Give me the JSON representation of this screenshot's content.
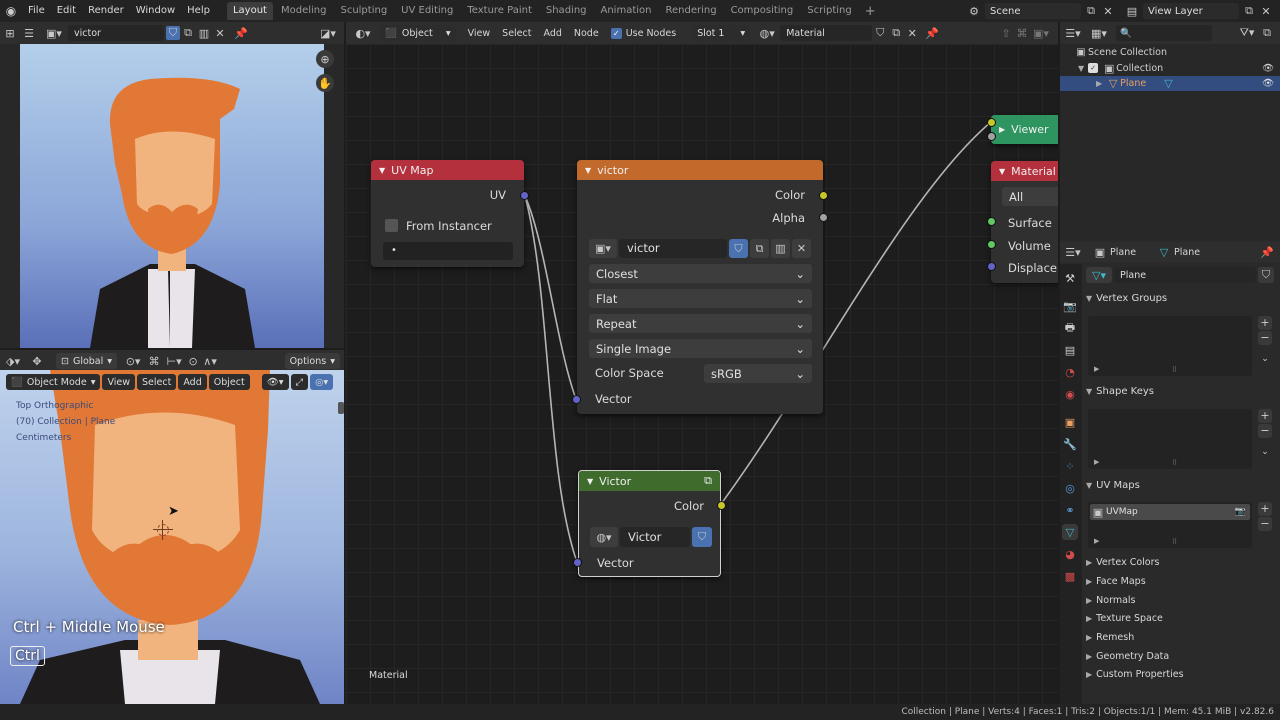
{
  "topbar": {
    "menus": [
      "File",
      "Edit",
      "Render",
      "Window",
      "Help"
    ],
    "workspaces": [
      "Layout",
      "Modeling",
      "Sculpting",
      "UV Editing",
      "Texture Paint",
      "Shading",
      "Animation",
      "Rendering",
      "Compositing",
      "Scripting"
    ],
    "active_workspace": "Layout",
    "scene": "Scene",
    "view_layer": "View Layer"
  },
  "image_editor": {
    "image_name": "victor"
  },
  "viewport": {
    "transform": "Global",
    "options": "Options",
    "mode": "Object Mode",
    "menus": [
      "View",
      "Select",
      "Add",
      "Object"
    ],
    "overlay_lines": [
      "Top Orthographic",
      "(70) Collection | Plane",
      "Centimeters"
    ],
    "hint": "Ctrl + Middle Mouse",
    "key": "Ctrl"
  },
  "node_editor": {
    "type": "Object",
    "menus": [
      "View",
      "Select",
      "Add",
      "Node"
    ],
    "use_nodes_label": "Use Nodes",
    "slot": "Slot 1",
    "material": "Material",
    "footer_label": "Material",
    "uvmap_node": {
      "title": "UV Map",
      "output": "UV",
      "from_instancer": "From Instancer",
      "field_value": "•"
    },
    "image_node": {
      "title": "victor",
      "out_color": "Color",
      "out_alpha": "Alpha",
      "image_name": "victor",
      "interpolation": "Closest",
      "projection": "Flat",
      "extension": "Repeat",
      "source": "Single Image",
      "color_space_label": "Color Space",
      "color_space": "sRGB",
      "in_vector": "Vector"
    },
    "group_node": {
      "title": "Victor",
      "out_color": "Color",
      "group_name": "Victor",
      "in_vector": "Vector"
    },
    "viewer_node": {
      "title": "Viewer"
    },
    "material_output": {
      "title": "Material",
      "target": "All",
      "inputs": [
        "Surface",
        "Volume",
        "Displacement"
      ]
    }
  },
  "outliner": {
    "scene_collection": "Scene Collection",
    "collection": "Collection",
    "object": "Plane"
  },
  "properties": {
    "header_object": "Plane",
    "header_data": "Plane",
    "mesh_name": "Plane",
    "sections_open": [
      "Vertex Groups",
      "Shape Keys",
      "UV Maps"
    ],
    "uv_map_item": "UVMap",
    "sections_closed": [
      "Vertex Colors",
      "Face Maps",
      "Normals",
      "Texture Space",
      "Remesh",
      "Geometry Data",
      "Custom Properties"
    ]
  },
  "statusbar": {
    "text": "Collection | Plane | Verts:4 | Faces:1 | Tris:2 | Objects:1/1 | Mem: 45.1 MiB | v2.82.6"
  },
  "colors": {
    "uv_header": "#b3303c",
    "image_header": "#c26a2b",
    "group_header": "#3f6b2d",
    "viewer_header": "#2e9460",
    "output_header": "#b3303c",
    "socket_vector": "#6363c7",
    "socket_color": "#c7c729",
    "socket_float": "#a1a1a1",
    "socket_shader": "#63c763",
    "selection": "#334d80"
  }
}
